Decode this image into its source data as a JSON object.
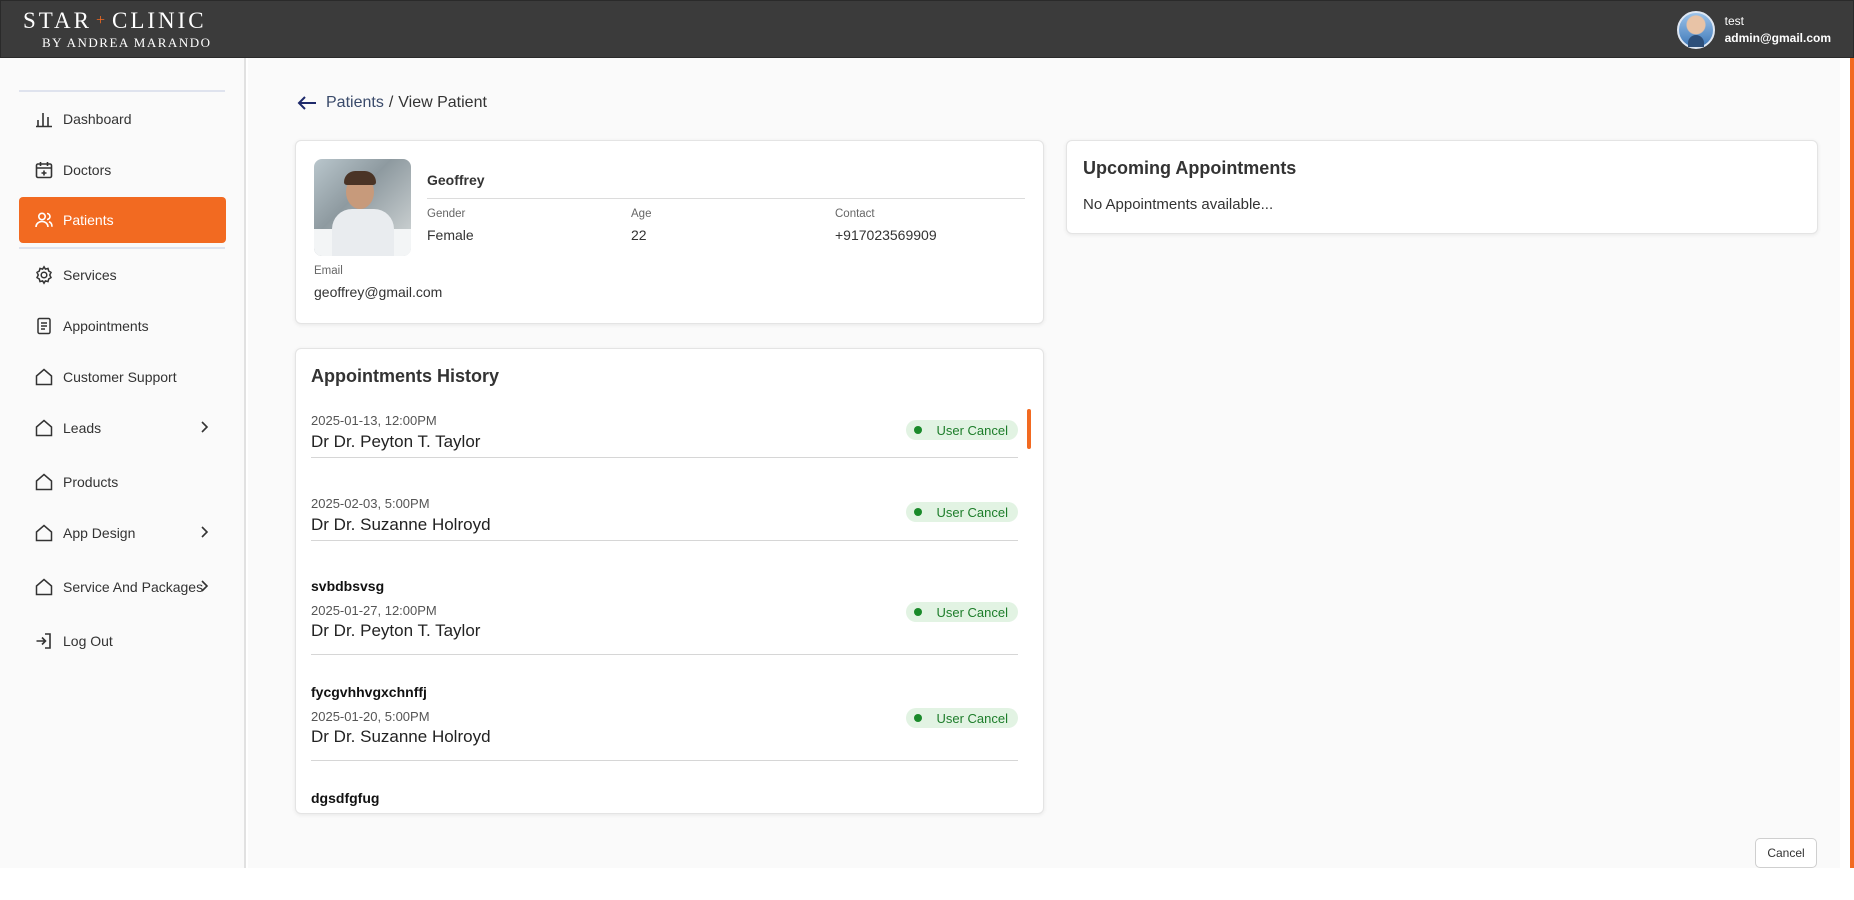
{
  "brand": {
    "line1_left": "STAR",
    "line1_right": "CLINIC",
    "line1_sep": "+",
    "line2": "BY ANDREA MARANDO"
  },
  "user": {
    "name": "test",
    "email": "admin@gmail.com"
  },
  "sidebar": {
    "items": [
      {
        "label": "Dashboard",
        "icon": "bar-chart-icon"
      },
      {
        "label": "Doctors",
        "icon": "calendar-plus-icon"
      },
      {
        "label": "Patients",
        "icon": "users-icon",
        "active": true
      },
      {
        "label": "Services",
        "icon": "gear-icon"
      },
      {
        "label": "Appointments",
        "icon": "document-icon"
      },
      {
        "label": "Customer Support",
        "icon": "home-icon"
      },
      {
        "label": "Leads",
        "icon": "home-icon",
        "has_submenu": true
      },
      {
        "label": "Products",
        "icon": "home-icon"
      },
      {
        "label": "App Design",
        "icon": "home-icon",
        "has_submenu": true
      },
      {
        "label": "Service And Packages",
        "icon": "home-icon",
        "has_submenu": true
      },
      {
        "label": "Log Out",
        "icon": "logout-icon"
      }
    ]
  },
  "breadcrumb": {
    "parent": "Patients",
    "separator": "/",
    "current": "View Patient"
  },
  "patient": {
    "name": "Geoffrey",
    "gender_label": "Gender",
    "gender": "Female",
    "age_label": "Age",
    "age": "22",
    "contact_label": "Contact",
    "contact": "+917023569909",
    "email_label": "Email",
    "email": "geoffrey@gmail.com"
  },
  "upcoming": {
    "title": "Upcoming Appointments",
    "empty_text": "No Appointments available..."
  },
  "history": {
    "title": "Appointments History",
    "items": [
      {
        "code": "",
        "datetime": "2025-01-13, 12:00PM",
        "doctor": "Dr Dr. Peyton T. Taylor",
        "status": "User Cancel"
      },
      {
        "code": "",
        "datetime": "2025-02-03, 5:00PM",
        "doctor": "Dr Dr. Suzanne Holroyd",
        "status": "User Cancel"
      },
      {
        "code": "svbdbsvsg",
        "datetime": "2025-01-27, 12:00PM",
        "doctor": "Dr Dr. Peyton T. Taylor",
        "status": "User Cancel"
      },
      {
        "code": "fycgvhhvgxchnffj",
        "datetime": "2025-01-20, 5:00PM",
        "doctor": "Dr Dr. Suzanne Holroyd",
        "status": "User Cancel"
      },
      {
        "code": "dgsdfgfug",
        "datetime": "",
        "doctor": "",
        "status": ""
      }
    ]
  },
  "actions": {
    "cancel_label": "Cancel"
  },
  "colors": {
    "accent": "#f26a21",
    "topbar": "#3b3b3b",
    "status_bg": "#e2f3e3",
    "status_text": "#1d7d2a"
  }
}
